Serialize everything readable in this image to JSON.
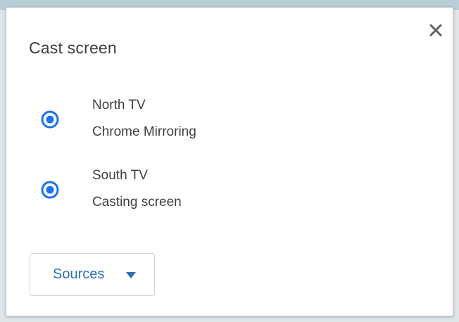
{
  "dialog": {
    "title": "Cast screen"
  },
  "sinks": [
    {
      "name": "North TV",
      "status": "Chrome Mirroring",
      "selected": true
    },
    {
      "name": "South TV",
      "status": "Casting screen",
      "selected": true
    }
  ],
  "sources": {
    "label": "Sources"
  },
  "icons": {
    "close": "close-icon",
    "radio": "radio-selected-icon",
    "caret": "caret-down-icon"
  },
  "colors": {
    "accent": "#1a73e8",
    "link": "#2f6fb5",
    "text": "#3c4043"
  }
}
